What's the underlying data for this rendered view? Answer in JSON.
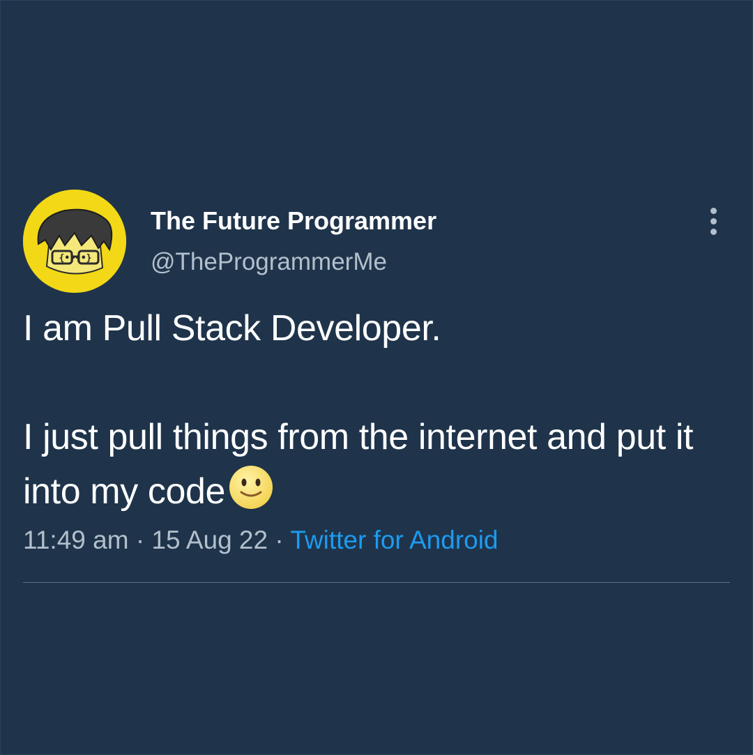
{
  "tweet": {
    "author": {
      "display_name": "The Future Programmer",
      "handle": "@TheProgrammerMe",
      "avatar_icon": "avatar-cartoon-programmer",
      "avatar_text": "{•}{•}"
    },
    "more_icon": "more-vertical-icon",
    "body": {
      "line1": "I am Pull Stack Developer.",
      "line2": "I just pull things from the internet and put it into my code",
      "emoji": "slightly-smiling-face"
    },
    "meta": {
      "time": "11:49 am",
      "separator": "·",
      "date": "15 Aug 22",
      "source": "Twitter for Android"
    }
  },
  "colors": {
    "background": "#1f344b",
    "primary_text": "#ffffff",
    "secondary_text": "#b3c0cc",
    "link": "#1d9bf0",
    "avatar_bg": "#f2d816"
  }
}
